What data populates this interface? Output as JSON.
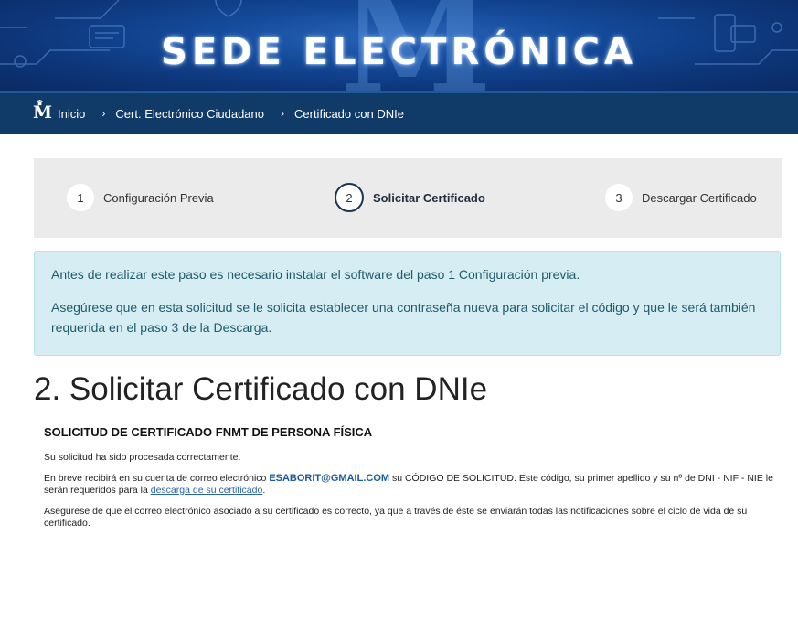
{
  "header": {
    "title": "SEDE ELECTRÓNICA",
    "logo_letter": "M"
  },
  "breadcrumb": {
    "items": [
      "Inicio",
      "Cert. Electrónico Ciudadano",
      "Certificado con DNIe"
    ],
    "separator": "›"
  },
  "stepper": {
    "steps": [
      {
        "num": "1",
        "label": "Configuración Previa",
        "active": false
      },
      {
        "num": "2",
        "label": "Solicitar Certificado",
        "active": true
      },
      {
        "num": "3",
        "label": "Descargar Certificado",
        "active": false
      }
    ]
  },
  "alert": {
    "line1": "Antes de realizar este paso es necesario instalar el software del paso 1 Configuración previa.",
    "line2": "Asegúrese que en esta solicitud se le solicita establecer una contraseña nueva para solicitar el código y que le será también requerida en el paso 3 de la Descarga."
  },
  "main": {
    "title": "2. Solicitar Certificado con DNIe",
    "subtitle": "SOLICITUD DE CERTIFICADO FNMT DE PERSONA FÍSICA",
    "p1": "Su solicitud ha sido procesada correctamente.",
    "p2_before": "En breve recibirá en su cuenta de correo electrónico ",
    "p2_email": "ESABORIT@GMAIL.COM",
    "p2_after": " su CÓDIGO DE SOLICITUD. Este código, su primer apellido y su nº de DNI - NIF - NIE le serán requeridos para la ",
    "p2_link": "descarga de su certificado",
    "p2_end": ".",
    "p3": "Asegúrese de que el correo electrónico asociado a su certificado es correcto, ya que a través de éste se enviarán todas las notificaciones sobre el ciclo de vida de su certificado."
  },
  "colors": {
    "banner": "#144a9a",
    "crumbbar": "#103a68",
    "alert_bg": "#d6eef3",
    "alert_text": "#1f5a6a",
    "active_step_border": "#1b3552",
    "link": "#2a62a8"
  }
}
